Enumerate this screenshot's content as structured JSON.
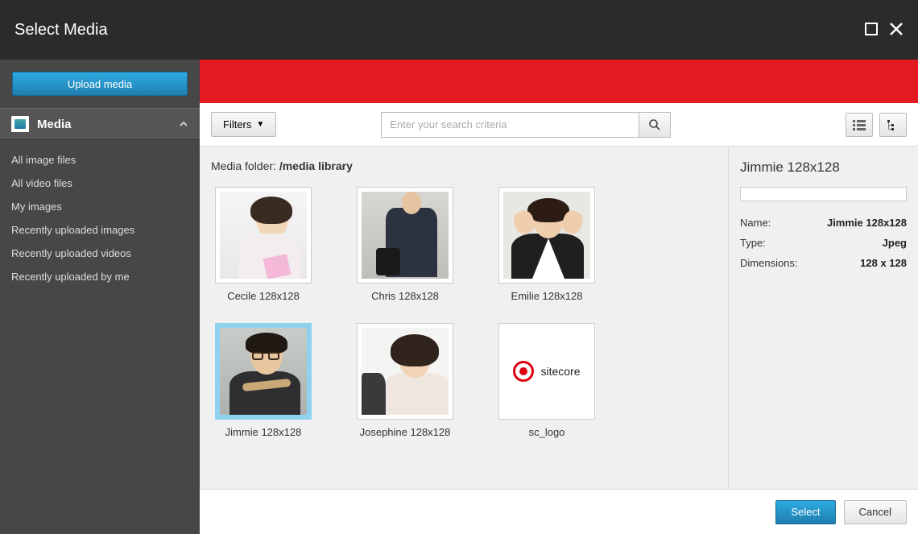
{
  "title": "Select Media",
  "sidebar": {
    "upload_label": "Upload media",
    "section_label": "Media",
    "filters": [
      "All image files",
      "All video files",
      "My images",
      "Recently uploaded images",
      "Recently uploaded videos",
      "Recently uploaded by me"
    ]
  },
  "toolbar": {
    "filters_label": "Filters",
    "search_placeholder": "Enter your search criteria"
  },
  "folder": {
    "prefix": "Media folder: ",
    "path": "/media library"
  },
  "items": [
    {
      "label": "Cecile 128x128",
      "selected": false,
      "kind": "portrait-f1"
    },
    {
      "label": "Chris 128x128",
      "selected": false,
      "kind": "portrait-m1"
    },
    {
      "label": "Emilie 128x128",
      "selected": false,
      "kind": "portrait-f2"
    },
    {
      "label": "Jimmie 128x128",
      "selected": true,
      "kind": "portrait-m2"
    },
    {
      "label": "Josephine 128x128",
      "selected": false,
      "kind": "portrait-f3"
    },
    {
      "label": "sc_logo",
      "selected": false,
      "kind": "logo",
      "logo_text": "sitecore"
    }
  ],
  "details": {
    "title": "Jimmie 128x128",
    "rows": [
      {
        "k": "Name:",
        "v": "Jimmie 128x128"
      },
      {
        "k": "Type:",
        "v": "Jpeg"
      },
      {
        "k": "Dimensions:",
        "v": "128 x 128"
      }
    ]
  },
  "footer": {
    "select": "Select",
    "cancel": "Cancel"
  }
}
